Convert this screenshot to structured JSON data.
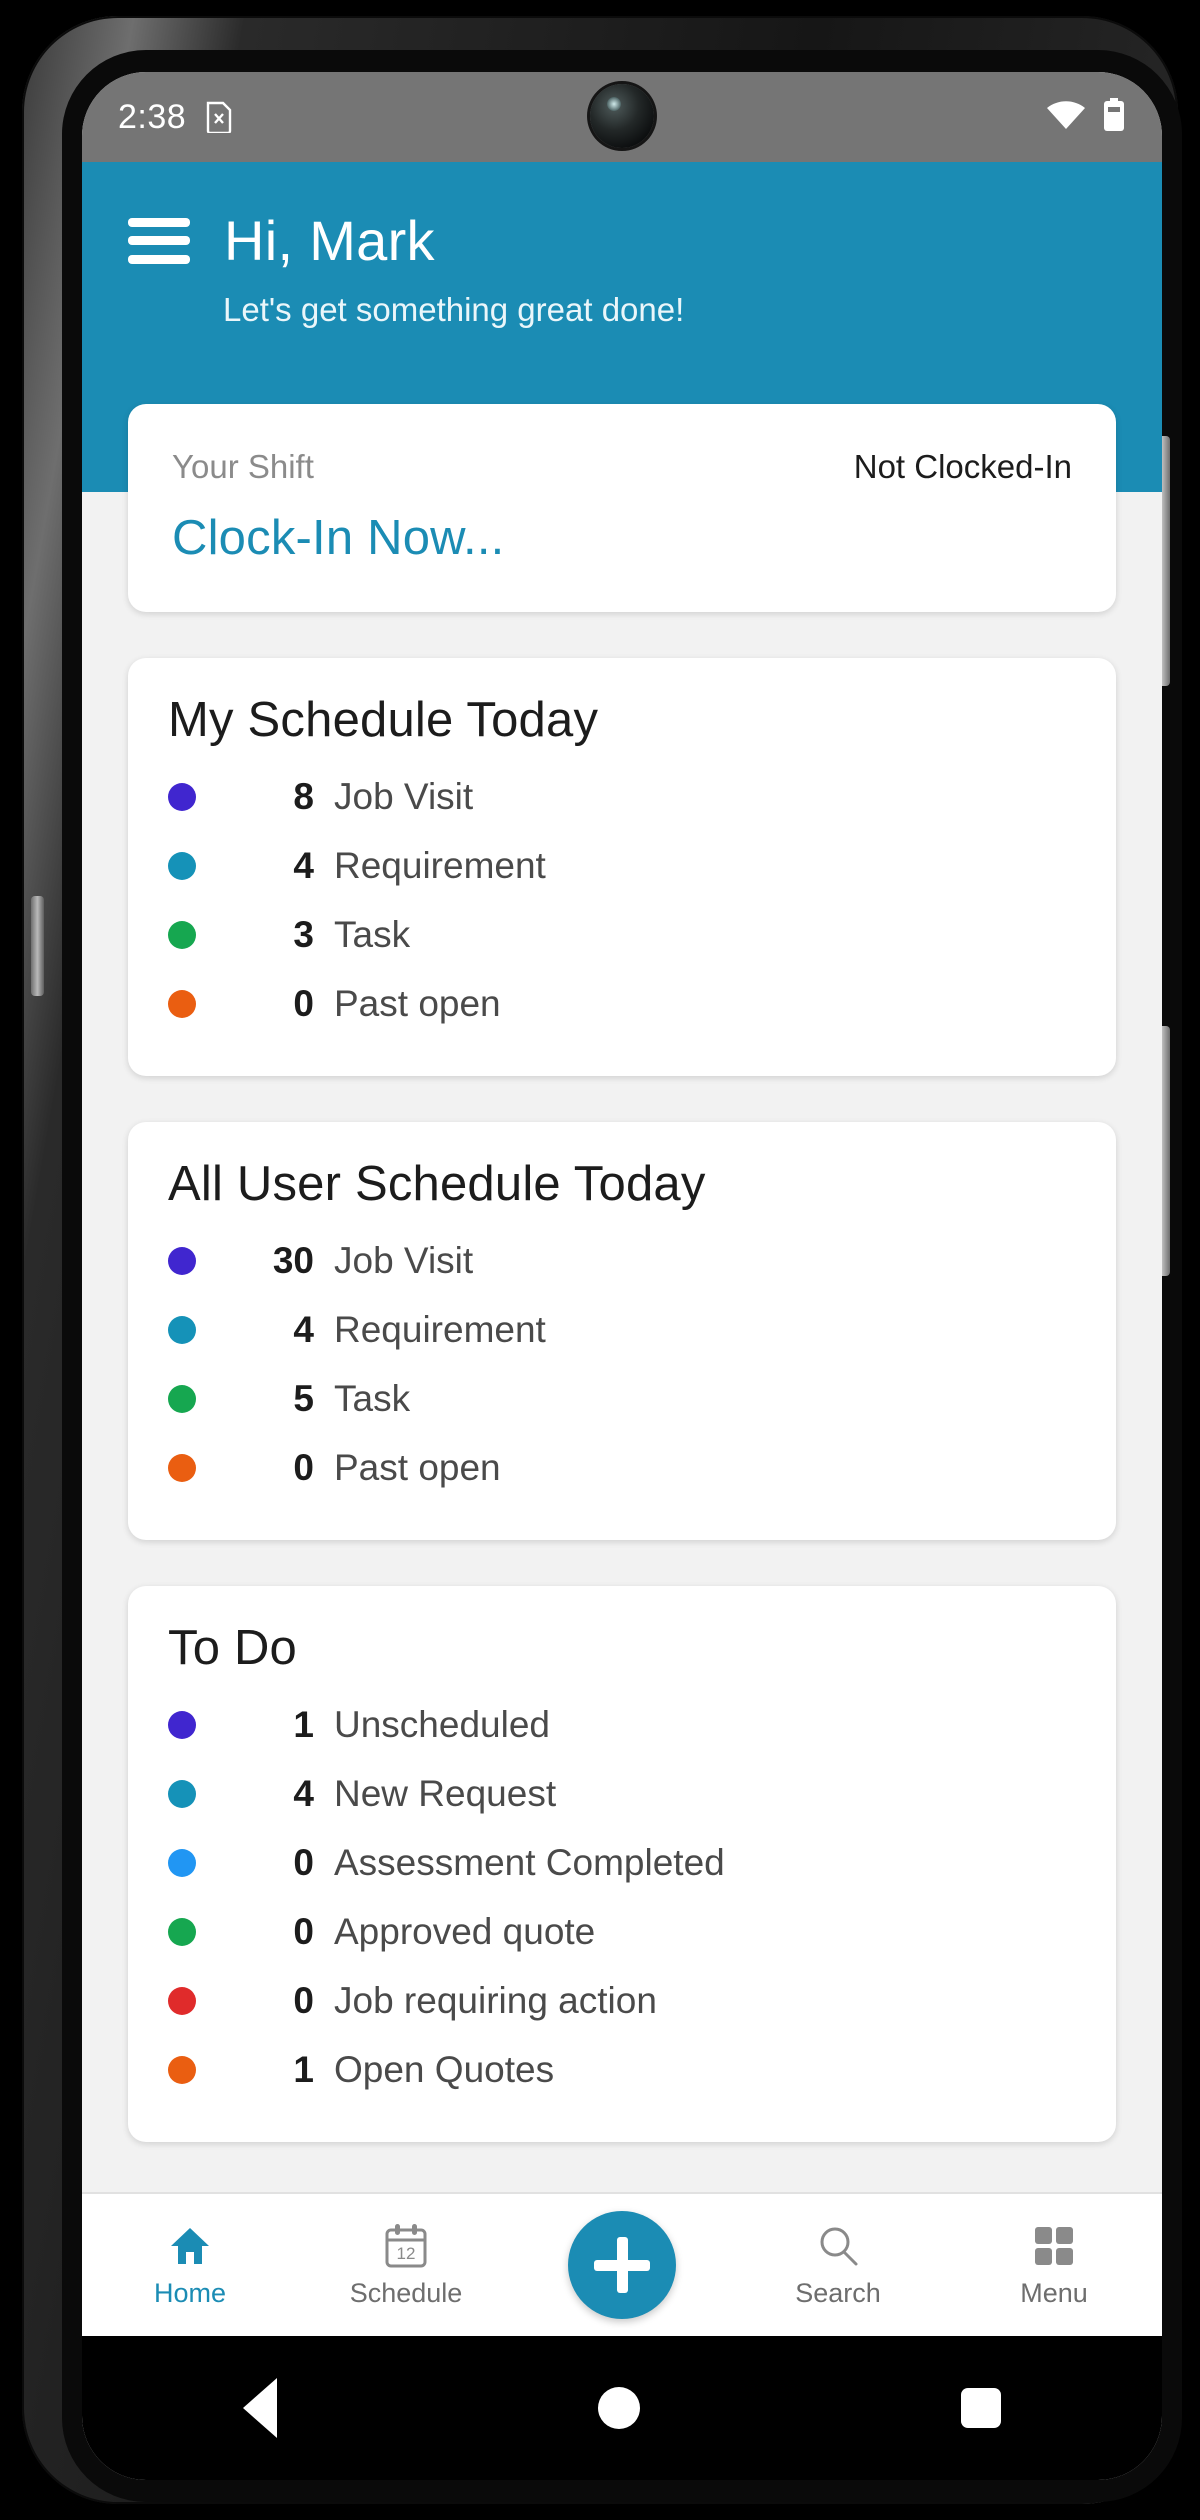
{
  "status_bar": {
    "clock": "2:38",
    "sim_icon": "sim-card-off-icon",
    "wifi_icon": "wifi-full-icon",
    "battery_icon": "battery-icon"
  },
  "header": {
    "menu_icon": "hamburger-menu-icon",
    "greeting": "Hi, Mark",
    "subtitle": "Let's get something great done!",
    "brand_color": "#1b8cb4"
  },
  "shift_card": {
    "label": "Your Shift",
    "status": "Not Clocked-In",
    "action": "Clock-In Now..."
  },
  "my_schedule": {
    "title": "My Schedule Today",
    "items": [
      {
        "count": "8",
        "label": "Job Visit",
        "color": "#4026cf"
      },
      {
        "count": "4",
        "label": "Requirement",
        "color": "#1592b8"
      },
      {
        "count": "3",
        "label": "Task",
        "color": "#16a750"
      },
      {
        "count": "0",
        "label": "Past open",
        "color": "#ea5e11"
      }
    ]
  },
  "all_user_schedule": {
    "title": "All User Schedule Today",
    "items": [
      {
        "count": "30",
        "label": "Job Visit",
        "color": "#4026cf"
      },
      {
        "count": "4",
        "label": "Requirement",
        "color": "#1592b8"
      },
      {
        "count": "5",
        "label": "Task",
        "color": "#16a750"
      },
      {
        "count": "0",
        "label": "Past open",
        "color": "#ea5e11"
      }
    ]
  },
  "todo": {
    "title": "To Do",
    "items": [
      {
        "count": "1",
        "label": "Unscheduled",
        "color": "#4026cf"
      },
      {
        "count": "4",
        "label": "New Request",
        "color": "#1592b8"
      },
      {
        "count": "0",
        "label": "Assessment Completed",
        "color": "#2196f3"
      },
      {
        "count": "0",
        "label": "Approved quote",
        "color": "#16a750"
      },
      {
        "count": "0",
        "label": "Job requiring action",
        "color": "#e02b2b"
      },
      {
        "count": "1",
        "label": "Open Quotes",
        "color": "#ea5e11"
      }
    ]
  },
  "bottom_nav": {
    "items": [
      {
        "label": "Home",
        "icon": "home-icon",
        "active": true
      },
      {
        "label": "Schedule",
        "icon": "calendar-icon",
        "active": false
      },
      {
        "label": "Search",
        "icon": "search-icon",
        "active": false
      },
      {
        "label": "Menu",
        "icon": "grid-menu-icon",
        "active": false
      }
    ],
    "fab_icon": "plus-icon",
    "calendar_day": "12"
  },
  "android_nav": {
    "back": "back-triangle-icon",
    "home": "home-circle-icon",
    "recents": "recents-square-icon"
  }
}
